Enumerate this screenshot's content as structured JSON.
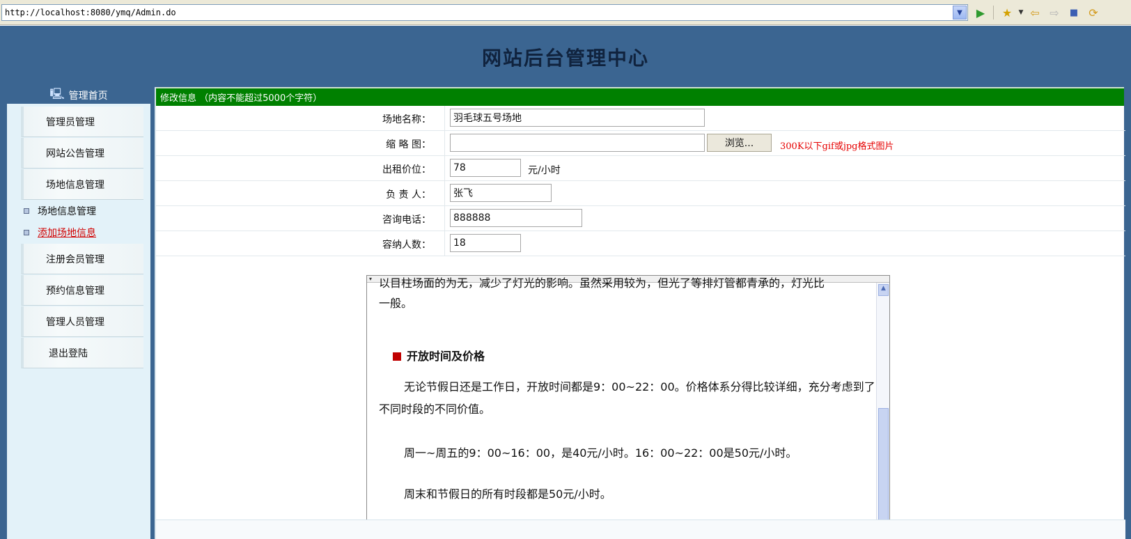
{
  "browser": {
    "url": "http://localhost:8080/ymq/Admin.do"
  },
  "header": {
    "title": "网站后台管理中心"
  },
  "sidebar": {
    "home": "管理首页",
    "items": [
      {
        "label": "管理员管理"
      },
      {
        "label": "网站公告管理"
      },
      {
        "label": "场地信息管理"
      },
      {
        "label": "注册会员管理"
      },
      {
        "label": "预约信息管理"
      },
      {
        "label": "管理人员管理"
      },
      {
        "label": "退出登陆"
      }
    ],
    "sub_items": [
      {
        "label": "场地信息管理",
        "active": false
      },
      {
        "label": "添加场地信息",
        "active": true
      }
    ]
  },
  "form": {
    "banner": "修改信息 （内容不能超过5000个字符）",
    "name_label": "场地名称：",
    "name_value": "羽毛球五号场地",
    "thumb_label": "缩 略 图：",
    "thumb_value": "",
    "browse_label": "浏览...",
    "thumb_hint": "300K以下gif或jpg格式图片",
    "price_label": "出租价位：",
    "price_value": "78",
    "price_unit": "元/小时",
    "manager_label": "负 责 人：",
    "manager_value": "张飞",
    "phone_label": "咨询电话：",
    "phone_value": "888888",
    "capacity_label": "容纳人数：",
    "capacity_value": "18"
  },
  "editor": {
    "cut_line": "以目柱场面的为无，减少了灯光的影响。虽然采用较为，但光了等排灯管都青承的，灯光比",
    "para1_end": "一般。",
    "heading": "开放时间及价格",
    "para2": "无论节假日还是工作日，开放时间都是9：00~22：00。价格体系分得比较详细，充分考虑到了不同时段的不同价值。",
    "para3": "周一~周五的9：00~16：00，是40元/小时。16：00~22：00是50元/小时。",
    "para4": "周末和节假日的所有时段都是50元/小时。"
  },
  "colors": {
    "frame_blue": "#3b6591",
    "banner_green": "#008000",
    "hint_red": "#e60000",
    "active_red": "#d10000",
    "heading_bullet": "#c00000"
  }
}
